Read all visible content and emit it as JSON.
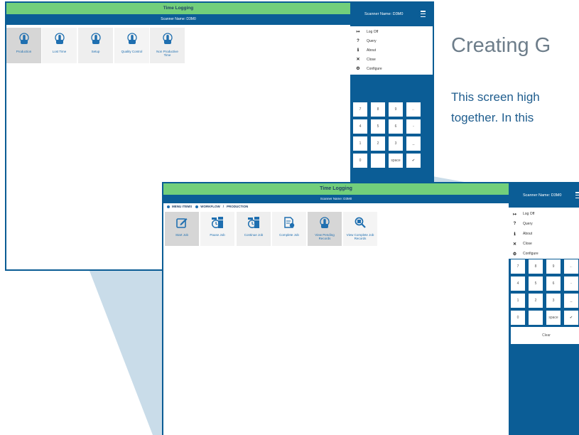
{
  "background": {
    "heading": "Creating G",
    "paragraph_line1": "This screen high",
    "paragraph_line2": "together. In this"
  },
  "colors": {
    "title_bar": "#72cf7b",
    "brand_blue": "#0b5d96",
    "tile_icon": "#1f6fb0",
    "wedge": "#c5d9e6"
  },
  "window1": {
    "title": "Time Logging",
    "scanner_label": "Scanner Name: D3M0",
    "side_header": "Scanner Name: D3M0",
    "menu": [
      {
        "icon": "logoff-icon",
        "glyph": "↦",
        "label": "Log Off"
      },
      {
        "icon": "question-icon",
        "glyph": "?",
        "label": "Query"
      },
      {
        "icon": "info-icon",
        "glyph": "ℹ",
        "label": "About"
      },
      {
        "icon": "close-box-icon",
        "glyph": "✕",
        "label": "Close"
      },
      {
        "icon": "gears-icon",
        "glyph": "⚙",
        "label": "Configure"
      }
    ],
    "keypad": [
      "7",
      "8",
      "9",
      "←",
      "4",
      "5",
      "6",
      "-",
      "1",
      "2",
      "3",
      "_",
      "0",
      "",
      "space",
      "✔"
    ],
    "tiles": [
      {
        "label": "Production",
        "icon": "hand-pointer-icon"
      },
      {
        "label": "Lost Time",
        "icon": "hand-pointer-icon"
      },
      {
        "label": "Setup",
        "icon": "hand-pointer-icon"
      },
      {
        "label": "Quality Control",
        "icon": "hand-pointer-icon"
      },
      {
        "label": "Non Productive Time",
        "icon": "hand-pointer-icon"
      }
    ]
  },
  "window2": {
    "title": "Time Logging",
    "scanner_label": "Scanner Name: D3M0",
    "side_header": "Scanner Name: D3M0",
    "breadcrumb": {
      "item1": "MENU ITEMS",
      "item2": "WORKFLOW",
      "separator": "/",
      "item3": "PRODUCTION"
    },
    "menu": [
      {
        "icon": "logoff-icon",
        "glyph": "↦",
        "label": "Log Off"
      },
      {
        "icon": "question-icon",
        "glyph": "?",
        "label": "Query"
      },
      {
        "icon": "info-icon",
        "glyph": "ℹ",
        "label": "About"
      },
      {
        "icon": "close-box-icon",
        "glyph": "✕",
        "label": "Close"
      },
      {
        "icon": "gears-icon",
        "glyph": "⚙",
        "label": "Configure"
      }
    ],
    "keypad": [
      "7",
      "8",
      "9",
      "←",
      "4",
      "5",
      "6",
      "-",
      "1",
      "2",
      "3",
      "_",
      "0",
      "",
      "space",
      "✔"
    ],
    "clear_label": "Clear",
    "tiles": [
      {
        "label": "Start Job",
        "icon": "edit-icon"
      },
      {
        "label": "Pause Job",
        "icon": "stopwatch-icon"
      },
      {
        "label": "Continue Job",
        "icon": "stopwatch-icon"
      },
      {
        "label": "Complete Job",
        "icon": "document-check-icon"
      },
      {
        "label": "View Pending Records",
        "icon": "hand-pointer-icon"
      },
      {
        "label": "View Complete Job Records",
        "icon": "magnifier-icon"
      }
    ]
  }
}
